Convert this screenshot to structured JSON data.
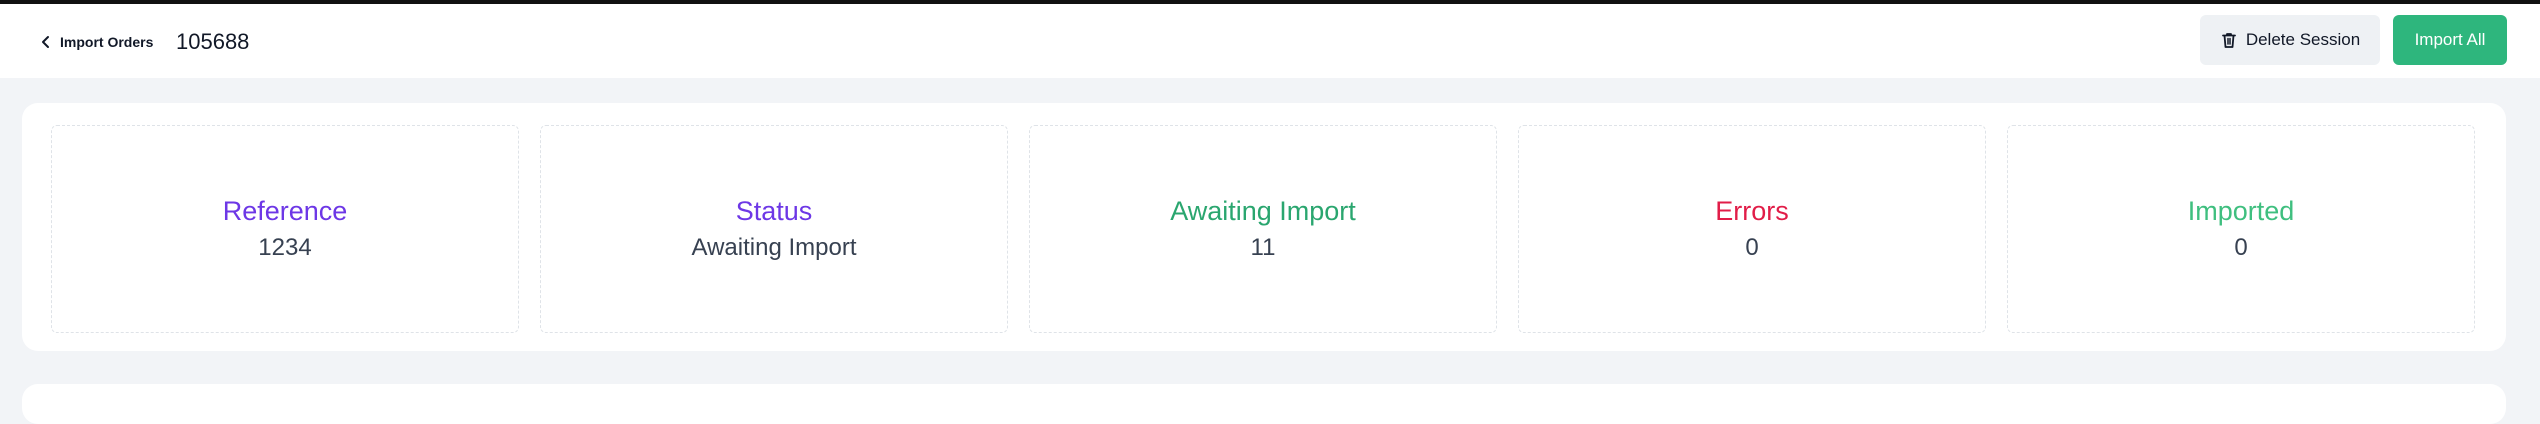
{
  "header": {
    "back_label": "Import Orders",
    "order_id": "105688",
    "delete_label": "Delete Session",
    "import_all_label": "Import All"
  },
  "cards": [
    {
      "title": "Reference",
      "value": "1234",
      "color": "#6d37e6"
    },
    {
      "title": "Status",
      "value": "Awaiting Import",
      "color": "#6d37e6"
    },
    {
      "title": "Awaiting Import",
      "value": "11",
      "color": "#2aa66f"
    },
    {
      "title": "Errors",
      "value": "0",
      "color": "#e11d48"
    },
    {
      "title": "Imported",
      "value": "0",
      "color": "#3fbf7f"
    }
  ],
  "icons": {
    "back": "chevron-left-icon",
    "delete": "trash-icon"
  },
  "colors": {
    "primary_button": "#2eb67d",
    "secondary_button": "#eef1f4"
  }
}
